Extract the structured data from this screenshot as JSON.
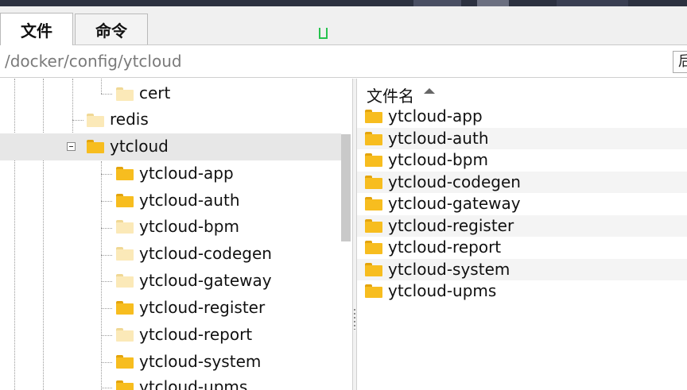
{
  "tabs": [
    {
      "label": "文件",
      "active": true
    },
    {
      "label": "命令",
      "active": false
    }
  ],
  "path": {
    "value": "/docker/config/ytcloud",
    "button_label": "后"
  },
  "tree": {
    "items": [
      {
        "label": "cert",
        "icon": "folder-icon",
        "style": "pale"
      },
      {
        "label": "redis",
        "icon": "folder-icon",
        "style": "pale"
      },
      {
        "label": "ytcloud",
        "icon": "folder-icon",
        "style": "full",
        "expanded": true,
        "selected": true
      },
      {
        "label": "ytcloud-app",
        "icon": "folder-icon",
        "style": "full"
      },
      {
        "label": "ytcloud-auth",
        "icon": "folder-icon",
        "style": "full"
      },
      {
        "label": "ytcloud-bpm",
        "icon": "folder-icon",
        "style": "pale"
      },
      {
        "label": "ytcloud-codegen",
        "icon": "folder-icon",
        "style": "pale"
      },
      {
        "label": "ytcloud-gateway",
        "icon": "folder-icon",
        "style": "pale"
      },
      {
        "label": "ytcloud-register",
        "icon": "folder-icon",
        "style": "full"
      },
      {
        "label": "ytcloud-report",
        "icon": "folder-icon",
        "style": "pale"
      },
      {
        "label": "ytcloud-system",
        "icon": "folder-icon",
        "style": "full"
      },
      {
        "label": "ytcloud-upms",
        "icon": "folder-icon",
        "style": "full"
      }
    ]
  },
  "filelist": {
    "header": "文件名",
    "sort": "ascending",
    "items": [
      "ytcloud-app",
      "ytcloud-auth",
      "ytcloud-bpm",
      "ytcloud-codegen",
      "ytcloud-gateway",
      "ytcloud-register",
      "ytcloud-report",
      "ytcloud-system",
      "ytcloud-upms"
    ]
  },
  "colors": {
    "folder": "#f7bd1f",
    "folder_pale": "#fbe9b8",
    "selection": "#e7e7e7",
    "cursor_mark": "#27c34f"
  }
}
